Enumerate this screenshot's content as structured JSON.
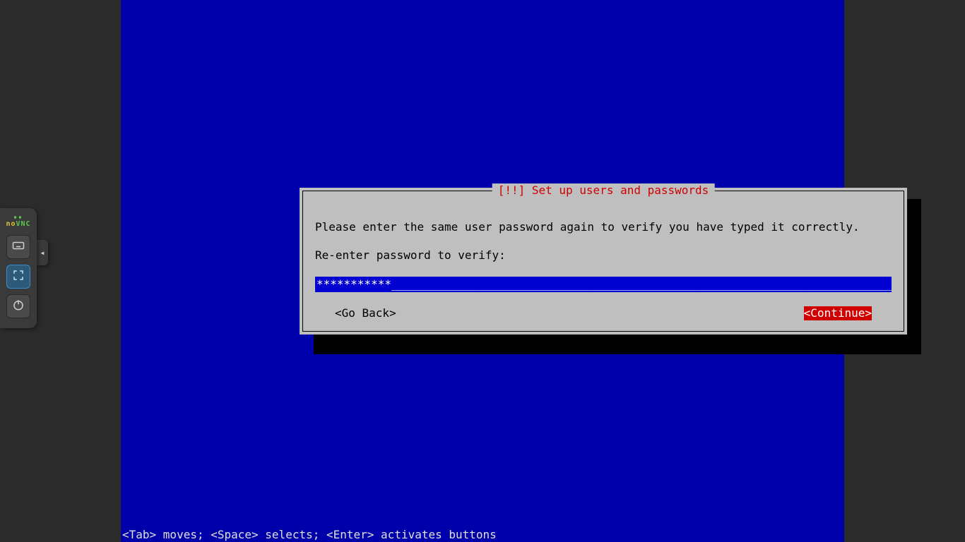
{
  "vnc": {
    "logo_no": "no",
    "logo_vnc": "VNC",
    "keyboard_icon": "keyboard-icon",
    "fullscreen_icon": "fullscreen-icon",
    "power_icon": "power-icon",
    "handle_glyph": "◂"
  },
  "dialog": {
    "title": "[!!] Set up users and passwords",
    "instruction": "Please enter the same user password again to verify you have typed it correctly.",
    "prompt": "Re-enter password to verify:",
    "password_masked": "***********_____________________________________________________________________________________",
    "go_back": "<Go Back>",
    "continue": "<Continue>"
  },
  "footer": {
    "hint": "<Tab> moves; <Space> selects; <Enter> activates buttons"
  }
}
